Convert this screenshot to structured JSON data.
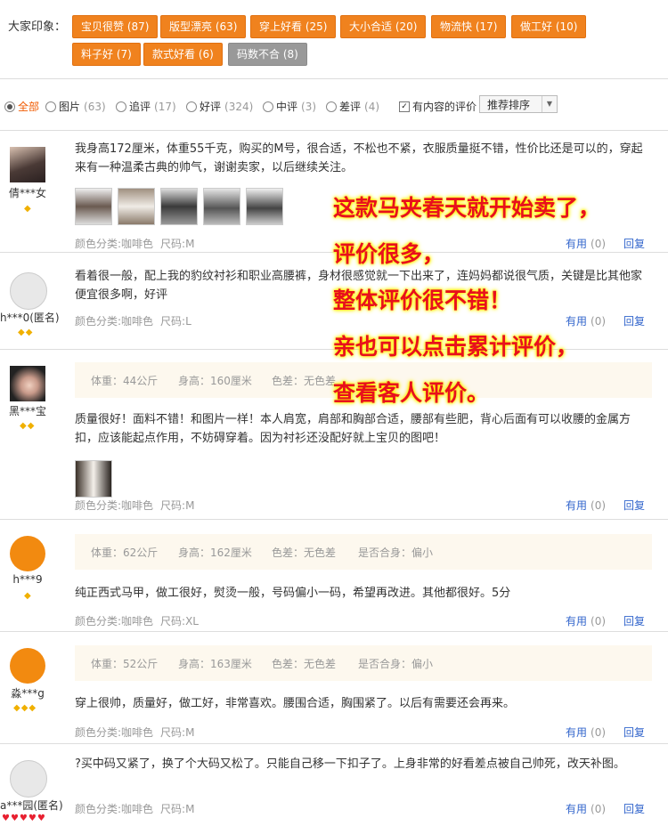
{
  "impressions": {
    "label": "大家印象：",
    "tags": [
      {
        "text": "宝贝很赞 (87)",
        "style": "orange"
      },
      {
        "text": "版型漂亮 (63)",
        "style": "orange"
      },
      {
        "text": "穿上好看 (25)",
        "style": "orange"
      },
      {
        "text": "大小合适 (20)",
        "style": "orange"
      },
      {
        "text": "物流快 (17)",
        "style": "orange"
      },
      {
        "text": "做工好 (10)",
        "style": "orange"
      },
      {
        "text": "料子好 (7)",
        "style": "orange"
      },
      {
        "text": "款式好看 (6)",
        "style": "orange"
      },
      {
        "text": "码数不合 (8)",
        "style": "gray"
      }
    ]
  },
  "filters": {
    "items": [
      {
        "label": "全部",
        "count": "",
        "selected": true
      },
      {
        "label": "图片",
        "count": "(63)"
      },
      {
        "label": "追评",
        "count": "(17)"
      },
      {
        "label": "好评",
        "count": "(324)"
      },
      {
        "label": "中评",
        "count": "(3)"
      },
      {
        "label": "差评",
        "count": "(4)"
      }
    ],
    "content_only": "有内容的评价",
    "sort": "推荐排序"
  },
  "common": {
    "useful": "有用",
    "reply": "回复"
  },
  "reviews": [
    {
      "user": "倩***女",
      "rank": "◆",
      "text": "我身高172厘米，体重55千克，购买的M号，很合适，不松也不紧，衣服质量挺不错，性价比还是可以的，穿起来有一种温柔古典的帅气，谢谢卖家，以后继续关注。",
      "color": "颜色分类:咖啡色",
      "size": "尺码:M",
      "useful_count": "(0)"
    },
    {
      "user": "h***0(匿名)",
      "rank": "◆◆",
      "text": "看着很一般，配上我的豹纹衬衫和职业高腰裤，身材很感觉就一下出来了，连妈妈都说很气质，关键是比其他家便宜很多啊，好评",
      "color": "颜色分类:咖啡色",
      "size": "尺码:L",
      "useful_count": "(0)"
    },
    {
      "user": "黑***宝",
      "rank": "◆◆",
      "attrs": [
        "体重：44公斤",
        "身高：160厘米",
        "色差：无色差"
      ],
      "text": "质量很好！面料不错！和图片一样！本人肩宽，肩部和胸部合适，腰部有些肥，背心后面有可以收腰的金属方扣，应该能起点作用，不妨碍穿着。因为衬衫还没配好就上宝贝的图吧！",
      "color": "颜色分类:咖啡色",
      "size": "尺码:M",
      "useful_count": "(0)"
    },
    {
      "user": "h***9",
      "rank": "◆",
      "attrs": [
        "体重：62公斤",
        "身高：162厘米",
        "色差：无色差",
        "是否合身：偏小"
      ],
      "text": "纯正西式马甲，做工很好，熨烫一般，号码偏小一码，希望再改进。其他都很好。5分",
      "color": "颜色分类:咖啡色",
      "size": "尺码:XL",
      "useful_count": "(0)"
    },
    {
      "user": "淼***g",
      "rank": "◆◆◆",
      "attrs": [
        "体重：52公斤",
        "身高：163厘米",
        "色差：无色差",
        "是否合身：偏小"
      ],
      "text": "穿上很帅，质量好，做工好，非常喜欢。腰围合适，胸围紧了。以后有需要还会再来。",
      "color": "颜色分类:咖啡色",
      "size": "尺码:M",
      "useful_count": "(0)"
    },
    {
      "user": "a***园(匿名)",
      "rank": "♥♥♥♥♥",
      "text": "?买中码又紧了，换了个大码又松了。只能自己移一下扣子了。上身非常的好看差点被自己帅死，改天补图。",
      "color": "颜色分类:咖啡色",
      "size": "尺码:M",
      "useful_count": "(0)"
    }
  ],
  "promo_overlay": [
    "这款马夹春天就开始卖了，",
    "评价很多，",
    "整体评价很不错！",
    "亲也可以点击累计评价，",
    "查看客人评价。"
  ]
}
